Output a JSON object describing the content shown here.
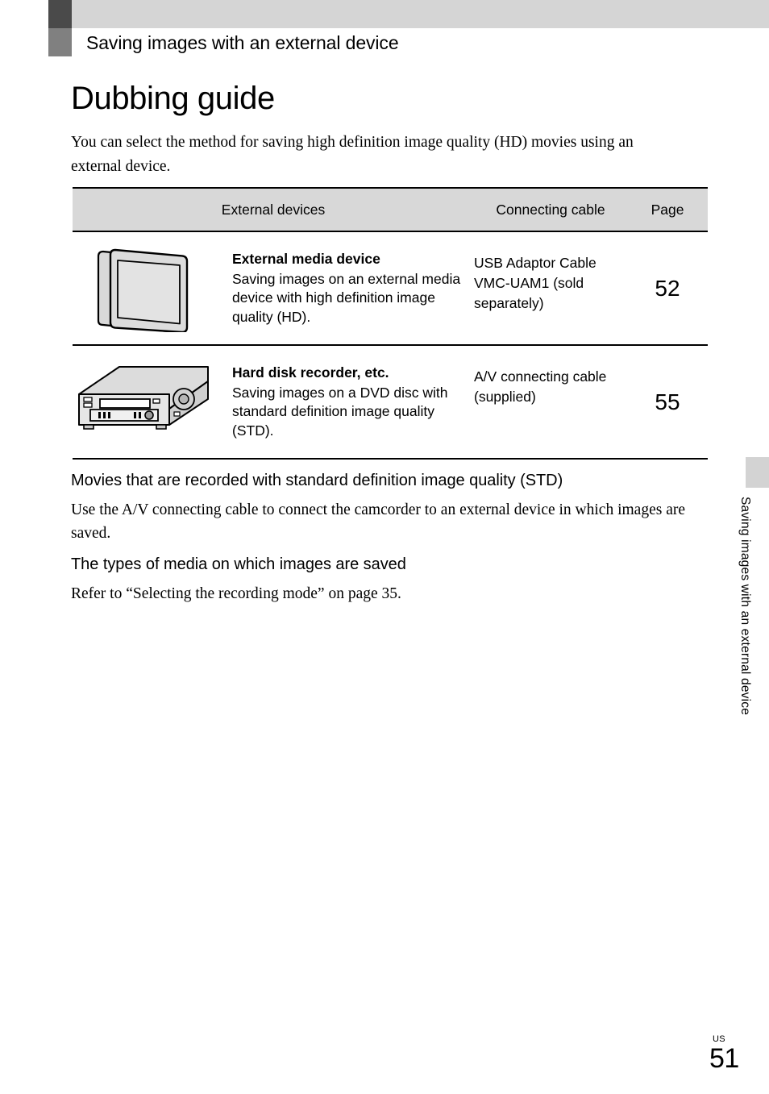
{
  "chapter": {
    "title": "Saving images with an external device"
  },
  "page": {
    "title": "Dubbing guide",
    "intro": "You can select the method for saving high definition image quality (HD) movies using an external device."
  },
  "table": {
    "headers": {
      "devices": "External devices",
      "cable": "Connecting cable",
      "page": "Page"
    },
    "rows": [
      {
        "icon": "external-media-device-icon",
        "name": "External media device",
        "description": "Saving images on an external media device with high definition image quality (HD).",
        "cable": "USB Adaptor Cable VMC-UAM1 (sold separately)",
        "page": "52"
      },
      {
        "icon": "hard-disk-recorder-icon",
        "name": "Hard disk recorder, etc.",
        "description": "Saving images on a DVD disc with standard definition image quality (STD).",
        "cable": "A/V connecting cable (supplied)",
        "page": "55"
      }
    ]
  },
  "sections": [
    {
      "heading": "Movies that are recorded with standard definition image quality (STD)",
      "body": "Use the A/V connecting cable to connect the camcorder to an external device in which images are saved."
    },
    {
      "heading": "The types of media on which images are saved",
      "body": "Refer to “Selecting the recording mode” on page 35."
    }
  ],
  "side_tab": {
    "label": "Saving images with an external device"
  },
  "footer": {
    "locale": "US",
    "page_number": "51"
  },
  "colors": {
    "band_gray": "#d5d5d5",
    "marker_dark": "#4a4a4a",
    "marker_gray": "#808080",
    "table_header_gray": "#d8d8d8",
    "side_tab_gray": "#d3d3d3"
  }
}
